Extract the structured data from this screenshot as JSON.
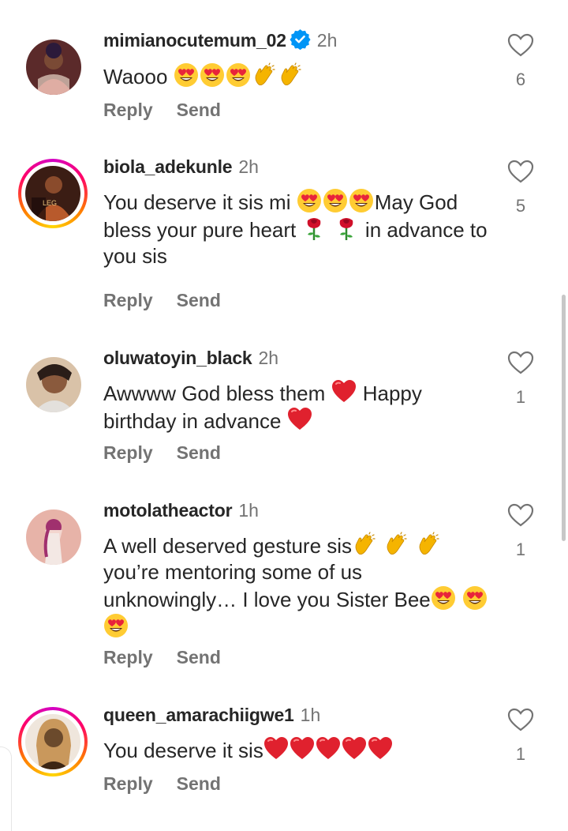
{
  "comments": [
    {
      "username": "mimianocutemum_02",
      "verified": true,
      "time": "2h",
      "text": "Waooo",
      "emojis": [
        "heart-eyes",
        "heart-eyes",
        "heart-eyes",
        "clap",
        "clap"
      ],
      "reply_label": "Reply",
      "send_label": "Send",
      "likes": "6",
      "avatar_colors": [
        "#5b2a2a",
        "#c94d4d",
        "#2b1a3a"
      ],
      "has_story_ring": false
    },
    {
      "username": "biola_adekunle",
      "verified": false,
      "time": "2h",
      "text_parts": [
        "You deserve it sis mi ",
        "May God bless your pure heart ",
        " in advance to you sis"
      ],
      "reply_label": "Reply",
      "send_label": "Send",
      "likes": "5",
      "avatar_colors": [
        "#3b1d14",
        "#b85a2c",
        "#1e0d0a"
      ],
      "has_story_ring": true
    },
    {
      "username": "oluwatoyin_black",
      "verified": false,
      "time": "2h",
      "text_parts": [
        "Awwww God bless them ",
        " Happy birthday in advance "
      ],
      "reply_label": "Reply",
      "send_label": "Send",
      "likes": "1",
      "avatar_colors": [
        "#2a1d18",
        "#8a5a3d",
        "#d9c2a8"
      ],
      "has_story_ring": false
    },
    {
      "username": "motolatheactor",
      "verified": false,
      "time": "1h",
      "text_parts": [
        "A well deserved gesture sis",
        " you’re mentoring some of us unknowingly… I love you Sister Bee"
      ],
      "reply_label": "Reply",
      "send_label": "Send",
      "likes": "1",
      "avatar_colors": [
        "#e7b3a8",
        "#a0306e",
        "#f3d6cf"
      ],
      "has_story_ring": false
    },
    {
      "username": "queen_amarachiigwe1",
      "verified": false,
      "time": "1h",
      "text": "You deserve it sis",
      "reply_label": "Reply",
      "send_label": "Send",
      "likes": "1",
      "avatar_colors": [
        "#6b4a2c",
        "#c9985c",
        "#3d2614"
      ],
      "has_story_ring": true
    }
  ],
  "colors": {
    "text": "#262626",
    "muted": "#737373",
    "verified": "#0095f6",
    "heart": "#e0212e"
  }
}
